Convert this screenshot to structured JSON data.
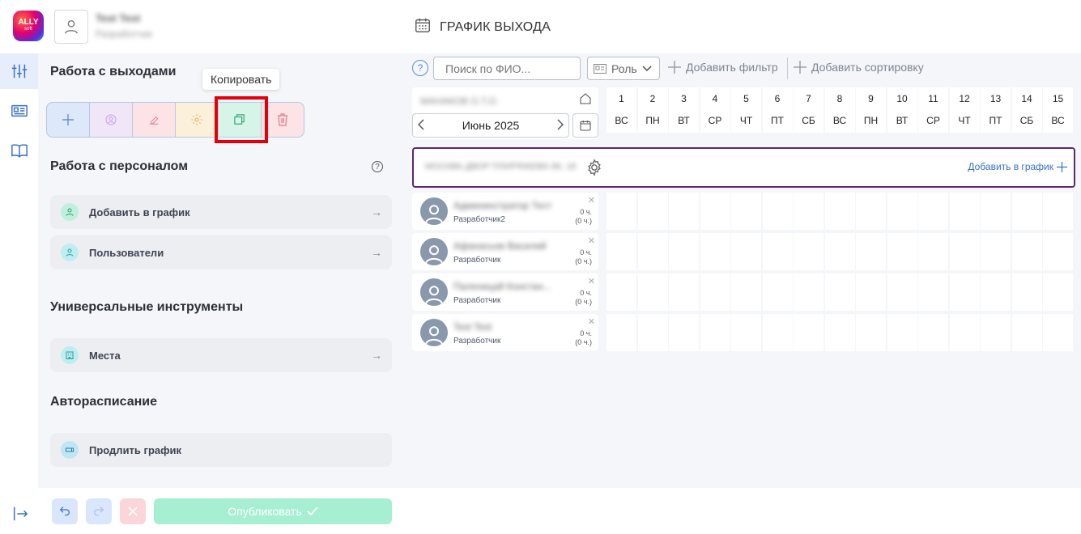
{
  "header": {
    "logo_text": "ALLY",
    "logo_sub": "soft",
    "user_name": "Test Test",
    "user_role": "Разработчик",
    "page_title": "ГРАФИК ВЫХОДА"
  },
  "panel": {
    "work_title": "Работа с выходами",
    "tooltip": "Копировать",
    "staff_title": "Работа с персоналом",
    "staff_items": [
      {
        "label": "Добавить в график"
      },
      {
        "label": "Пользователи"
      }
    ],
    "universal_title": "Универсальные инструменты",
    "universal_items": [
      {
        "label": "Места"
      }
    ],
    "auto_title": "Авторасписание",
    "auto_items": [
      {
        "label": "Продлить график"
      }
    ],
    "publish_label": "Опубликовать"
  },
  "filters": {
    "help": "?",
    "search_placeholder": "Поиск по ФИО...",
    "role_label": "Роль",
    "add_filter": "Добавить фильтр",
    "add_sort": "Добавить сортировку"
  },
  "calendar": {
    "location": "МАНАКОВ О.Т.О.",
    "month": "Июнь 2025",
    "days": [
      {
        "n": "1",
        "w": "ВС"
      },
      {
        "n": "2",
        "w": "ПН"
      },
      {
        "n": "3",
        "w": "ВТ"
      },
      {
        "n": "4",
        "w": "СР"
      },
      {
        "n": "5",
        "w": "ЧТ"
      },
      {
        "n": "6",
        "w": "ПТ"
      },
      {
        "n": "7",
        "w": "СБ"
      },
      {
        "n": "8",
        "w": "ВС"
      },
      {
        "n": "9",
        "w": "ПН"
      },
      {
        "n": "10",
        "w": "ВТ"
      },
      {
        "n": "11",
        "w": "СР"
      },
      {
        "n": "12",
        "w": "ЧТ"
      },
      {
        "n": "13",
        "w": "ПТ"
      },
      {
        "n": "14",
        "w": "СБ"
      },
      {
        "n": "15",
        "w": "ВС"
      }
    ]
  },
  "group": {
    "name": "МОСКВА ДВОР ПЛИРЯЖЕВА 86, 18",
    "add_label": "Добавить в график"
  },
  "employees": [
    {
      "name": "Админинстратор Тест",
      "role": "Разработчик2",
      "hours": "0 ч.",
      "hours_sub": "(0 ч.)"
    },
    {
      "name": "Афанасьев Василий",
      "role": "Разработчик",
      "hours": "0 ч.",
      "hours_sub": "(0 ч.)"
    },
    {
      "name": "Паленицай Констан...",
      "role": "Разработчик",
      "hours": "0 ч.",
      "hours_sub": "(0 ч.)"
    },
    {
      "name": "Test Test",
      "role": "Разработчик",
      "hours": "0 ч.",
      "hours_sub": "(0 ч.)"
    }
  ],
  "colors": {
    "accent": "#3a6fc9",
    "group_border": "#5a2a6b",
    "highlight": "#e3000b",
    "publish_bg": "#a7efd3"
  }
}
